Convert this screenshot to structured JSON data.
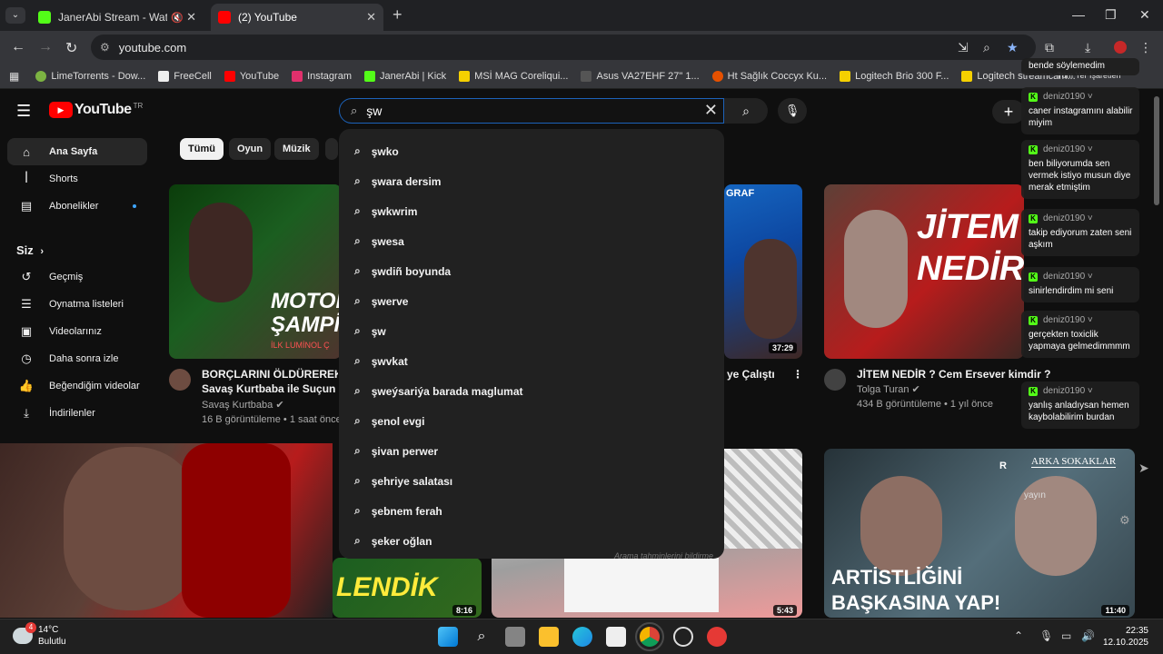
{
  "browser": {
    "tabs": [
      {
        "title": "JanerAbi Stream - Watch Li",
        "favicon_color": "#53fc18",
        "muted": true
      },
      {
        "title": "(2) YouTube",
        "favicon_color": "#ff0000",
        "active": true
      }
    ],
    "url": "youtube.com",
    "bookmarks": [
      {
        "label": "LimeTorrents - Dow...",
        "color": "#7cb342"
      },
      {
        "label": "FreeCell",
        "color": "#eeeeee"
      },
      {
        "label": "YouTube",
        "color": "#ff0000"
      },
      {
        "label": "Instagram",
        "color": "#e1306c"
      },
      {
        "label": "JanerAbi | Kick",
        "color": "#53fc18"
      },
      {
        "label": "MSİ MAG Coreliqui...",
        "color": "#f5d000"
      },
      {
        "label": "Asus VA27EHF 27\" 1...",
        "color": "#555555"
      },
      {
        "label": "Ht Sağlık Coccyx Ku...",
        "color": "#e65100"
      },
      {
        "label": "Logitech Brio 300 F...",
        "color": "#f5d000"
      },
      {
        "label": "Logitech streamcam...",
        "color": "#f5d000"
      }
    ],
    "bookmark_overflow": "Tüm Yer İşaretleri"
  },
  "youtube": {
    "logo_text": "YouTube",
    "region": "TR",
    "search": {
      "value": "şw"
    },
    "chips": [
      "Tümü",
      "Oyun",
      "Müzik"
    ],
    "sidebar": {
      "items": [
        {
          "label": "Ana Sayfa",
          "icon": "home-icon",
          "active": true
        },
        {
          "label": "Shorts",
          "icon": "shorts-icon"
        },
        {
          "label": "Abonelikler",
          "icon": "subscriptions-icon",
          "dot": true
        }
      ],
      "you_heading": "Siz",
      "you_items": [
        {
          "label": "Geçmiş",
          "icon": "history-icon"
        },
        {
          "label": "Oynatma listeleri",
          "icon": "playlist-icon"
        },
        {
          "label": "Videolarınız",
          "icon": "your-videos-icon"
        },
        {
          "label": "Daha sonra izle",
          "icon": "watch-later-icon"
        },
        {
          "label": "Beğendiğim videolar",
          "icon": "like-icon"
        },
        {
          "label": "İndirilenler",
          "icon": "download-icon"
        }
      ]
    },
    "suggestions": [
      "şwko",
      "şwara dersim",
      "şwkwrim",
      "şwesa",
      "şwdiñ boyunda",
      "şwerve",
      "şw",
      "şwvkat",
      "şweýsariýa barada maglumat",
      "şenol evgi",
      "şivan perwer",
      "şehriye salatası",
      "şebnem ferah",
      "şeker oğlan"
    ],
    "suggestion_note": "Arama tahminlerini bildirme",
    "videos": [
      {
        "title": "BORÇLARINI ÖLDÜREREK Ö",
        "title2": "Savaş Kurtbaba ile Suçun Ar",
        "channel": "Savaş Kurtbaba",
        "views": "16 B görüntüleme",
        "age": "1 saat önce",
        "thumb_text": "MOTOK ŞAMPİYON",
        "thumb_sub": "İLK LUMİNOL Ç"
      },
      {
        "title": "ye Çalıştı",
        "duration": "37:29",
        "thumb_text": "GRAF"
      },
      {
        "title": "JİTEM NEDİR ? Cem Ersever kimdir ?",
        "channel": "Tolga Turan",
        "views": "434 B görüntüleme",
        "age": "1 yıl önce",
        "thumb_text": "JİTEM NEDİR"
      },
      {
        "duration": "8:16",
        "thumb_text": "LENDİK"
      },
      {
        "duration": "5:43"
      },
      {
        "duration": "11:40",
        "thumb_text": "ARTİSTLİĞİNİ BAŞKASINA YAP!",
        "thumb_top": "ARKA SOKAKLAR"
      }
    ]
  },
  "chat": {
    "first_line": "bende söylemedim",
    "messages": [
      {
        "user": "deniz0190",
        "text": "caner instagramını alabilir miyim"
      },
      {
        "user": "deniz0190",
        "text": "ben biliyorumda sen vermek istiyo musun diye merak etmiştim"
      },
      {
        "user": "deniz0190",
        "text": "takip ediyorum zaten seni aşkım"
      },
      {
        "user": "deniz0190",
        "text": "sinirlendirdim mi seni"
      },
      {
        "user": "deniz0190",
        "text": "gerçekten toxiclik yapmaya gelmedimmmm"
      },
      {
        "user": "deniz0190",
        "text": "yanlış anladıysan hemen kaybolabilirim burdan"
      }
    ],
    "overlay_label": "yayın"
  },
  "taskbar": {
    "weather_temp": "14°C",
    "weather_desc": "Bulutlu",
    "notification_count": "4",
    "time": "22:35",
    "date": "12.10.2025"
  }
}
